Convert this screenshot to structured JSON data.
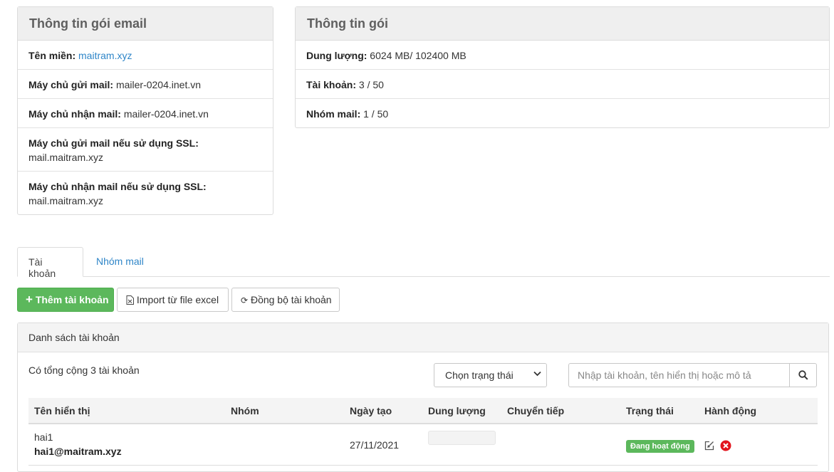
{
  "email_package": {
    "title": "Thông tin gói email",
    "domain_label": "Tên miền:",
    "domain_value": "maitram.xyz",
    "smtp_label": "Máy chủ gửi mail:",
    "smtp_value": "mailer-0204.inet.vn",
    "imap_label": "Máy chủ nhận mail:",
    "imap_value": "mailer-0204.inet.vn",
    "smtp_ssl_label": "Máy chủ gửi mail nếu sử dụng SSL:",
    "smtp_ssl_value": "mail.maitram.xyz",
    "imap_ssl_label": "Máy chủ nhận mail nếu sử dụng SSL:",
    "imap_ssl_value": "mail.maitram.xyz"
  },
  "package_info": {
    "title": "Thông tin gói",
    "storage_label": "Dung lượng:",
    "storage_value": "6024 MB/ 102400 MB",
    "accounts_label": "Tài khoản:",
    "accounts_value": "3 / 50",
    "groups_label": "Nhóm mail:",
    "groups_value": "1 / 50"
  },
  "tabs": [
    "Tài khoản",
    "Nhóm mail"
  ],
  "toolbar": {
    "add_label": "Thêm tài khoản",
    "import_label": "Import từ file excel",
    "sync_label": "Đồng bộ tài khoản"
  },
  "list": {
    "title": "Danh sách tài khoản",
    "total_text": "Có tổng cộng 3 tài khoản",
    "status_select": "Chọn trạng thái",
    "search_placeholder": "Nhập tài khoản, tên hiển thị hoặc mô tả",
    "columns": [
      "Tên hiển thị",
      "Nhóm",
      "Ngày tạo",
      "Dung lượng",
      "Chuyển tiếp",
      "Trạng thái",
      "Hành động"
    ],
    "rows": [
      {
        "display_name": "hai1",
        "email": "hai1@maitram.xyz",
        "group": "",
        "created": "27/11/2021",
        "usage": 0,
        "forward": "",
        "status": "Đang hoạt động"
      }
    ]
  },
  "colors": {
    "link": "#2f86c8",
    "success": "#5cb85c",
    "danger": "#e2141d"
  },
  "icons": [
    "plus-icon",
    "excel-file-icon",
    "sync-icon",
    "chevron-down-icon",
    "search-icon",
    "edit-icon",
    "delete-icon"
  ]
}
